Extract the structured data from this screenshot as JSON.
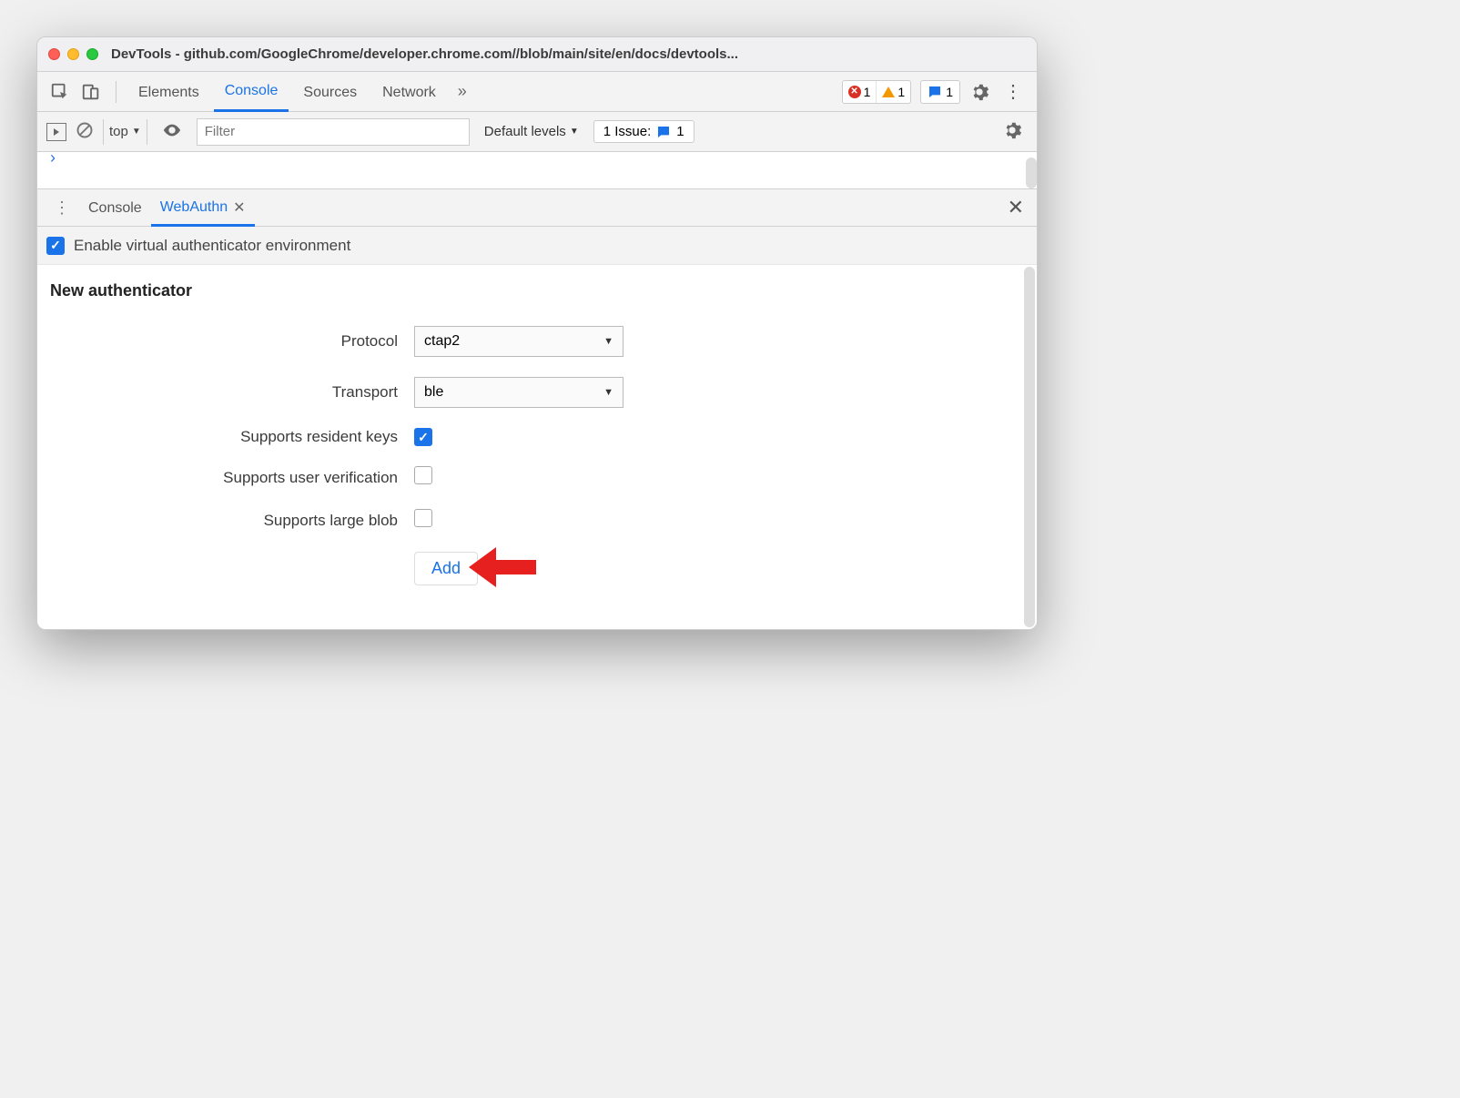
{
  "window": {
    "title": "DevTools - github.com/GoogleChrome/developer.chrome.com//blob/main/site/en/docs/devtools..."
  },
  "toolbar": {
    "tabs": [
      "Elements",
      "Console",
      "Sources",
      "Network"
    ],
    "active_tab": "Console",
    "errors": "1",
    "warnings": "1",
    "messages": "1"
  },
  "consolebar": {
    "context": "top",
    "filter_placeholder": "Filter",
    "level": "Default levels",
    "issues_label": "1 Issue:",
    "issues_count": "1"
  },
  "drawer": {
    "tabs": [
      {
        "label": "Console",
        "active": false,
        "closable": false
      },
      {
        "label": "WebAuthn",
        "active": true,
        "closable": true
      }
    ]
  },
  "webauthn": {
    "enable_label": "Enable virtual authenticator environment",
    "enable_checked": true,
    "section_title": "New authenticator",
    "fields": {
      "protocol": {
        "label": "Protocol",
        "value": "ctap2"
      },
      "transport": {
        "label": "Transport",
        "value": "ble"
      },
      "resident_keys": {
        "label": "Supports resident keys",
        "checked": true
      },
      "user_verification": {
        "label": "Supports user verification",
        "checked": false
      },
      "large_blob": {
        "label": "Supports large blob",
        "checked": false
      }
    },
    "add_button": "Add"
  }
}
